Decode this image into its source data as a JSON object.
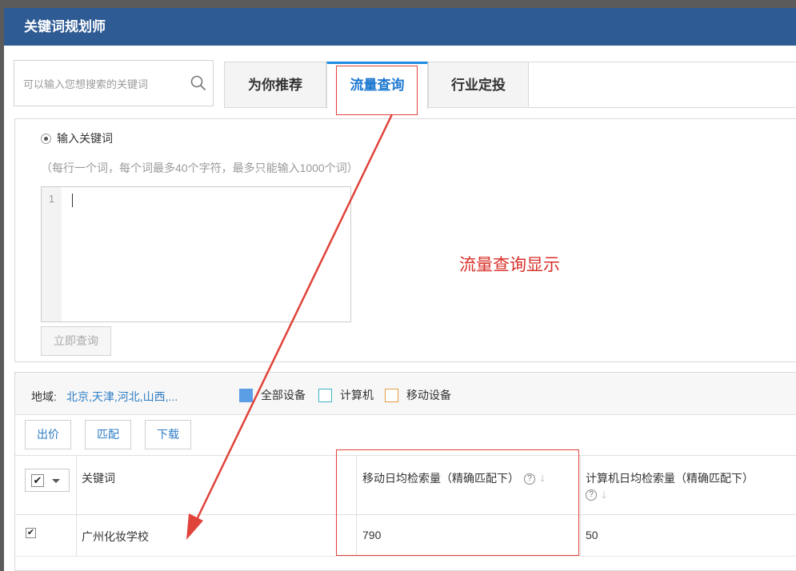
{
  "window": {
    "title": "关键词规划师"
  },
  "search": {
    "placeholder": "可以输入您想搜索的关键词"
  },
  "tabs": [
    {
      "label": "为你推荐"
    },
    {
      "label": "流量查询"
    },
    {
      "label": "行业定投"
    }
  ],
  "query": {
    "radio_label": "输入关键词",
    "hint": "（每行一个词，每个词最多40个字符，最多只能输入1000个词）",
    "line_number": "1",
    "submit_label": "立即查询",
    "annotation": "流量查询显示"
  },
  "filters": {
    "region_label": "地域:",
    "region_value": "北京,天津,河北,山西,...",
    "devices": [
      {
        "label": "全部设备",
        "color": "#5c9ee6"
      },
      {
        "label": "计算机",
        "color": "#3bb5c6"
      },
      {
        "label": "移动设备",
        "color": "#e49a45"
      }
    ]
  },
  "actions": {
    "bid": "出价",
    "match": "匹配",
    "download": "下载"
  },
  "table": {
    "columns": [
      {
        "label": "关键词"
      },
      {
        "label": "移动日均检索量（精确匹配下）"
      },
      {
        "label": "计算机日均检索量（精确匹配下）"
      }
    ],
    "rows": [
      {
        "keyword": "广州化妆学校",
        "mobile": "790",
        "pc": "50"
      }
    ]
  },
  "colors": {
    "titlebar": "#2f5b94",
    "accent": "#1d8ce0",
    "annotation": "#d9312a"
  }
}
